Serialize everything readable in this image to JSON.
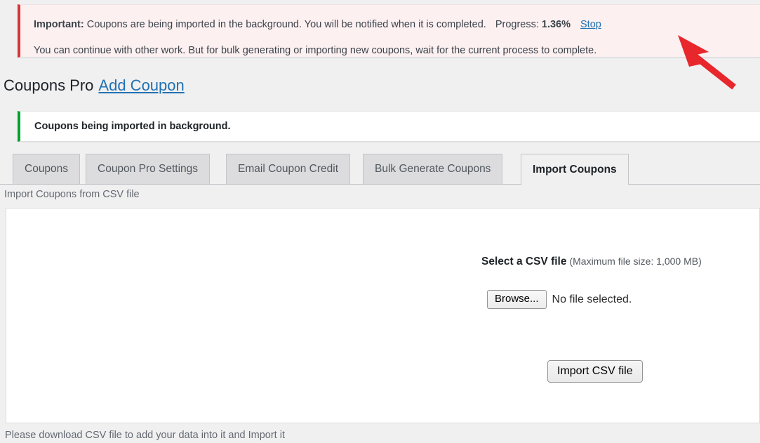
{
  "notice_important": {
    "label": "Important:",
    "message": " Coupons are being imported in the background. You will be notified when it is completed.",
    "progress_label": "Progress:",
    "progress_value": "1.36%",
    "stop_label": "Stop",
    "second_line": "You can continue with other work. But for bulk generating or importing new coupons, wait for the current process to complete.",
    "accent_color": "#d63638",
    "background_color": "#fcf0f1"
  },
  "heading": {
    "title": "Coupons Pro",
    "add_link": "Add Coupon"
  },
  "notice_success": {
    "message": "Coupons being imported in background.",
    "accent_color": "#00a32a"
  },
  "tabs": [
    {
      "label": "Coupons",
      "active": false
    },
    {
      "label": "Coupon Pro Settings",
      "active": false
    },
    {
      "label": "Email Coupon Credit",
      "active": false
    },
    {
      "label": "Bulk Generate Coupons",
      "active": false
    },
    {
      "label": "Import Coupons",
      "active": true
    }
  ],
  "import_panel": {
    "panel_label": "Import Coupons from CSV file",
    "select_file_label": "Select a CSV file",
    "max_size_note": "(Maximum file size: 1,000 MB)",
    "browse_button": "Browse...",
    "file_status": "No file selected.",
    "import_button": "Import CSV file"
  },
  "footer": {
    "note": "Please download CSV file to add your data into it and Import it"
  },
  "annotation": {
    "arrow_color": "#e8272c",
    "arrow_name": "red-pointer-arrow"
  }
}
